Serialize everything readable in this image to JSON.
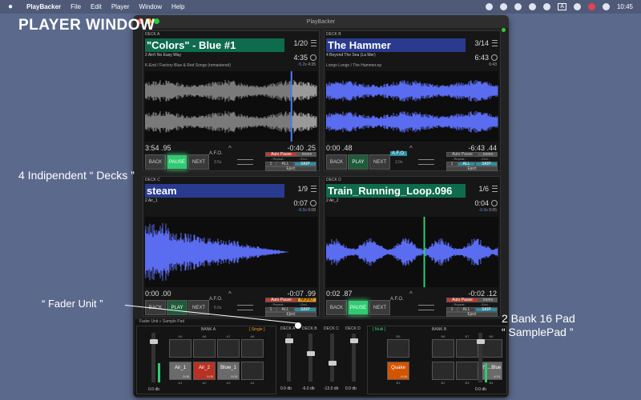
{
  "menubar": {
    "apple": "",
    "app": "PlayBacker",
    "items": [
      "File",
      "Edit",
      "Player",
      "Window",
      "Help"
    ],
    "lang": "A",
    "clock": "10:45"
  },
  "overlay": {
    "title": "PLAYER WINDOW",
    "decks_callout": "4 Indipendent “ Decks ”",
    "fader_callout": "“ Fader Unit ”",
    "pad_callout_1": "2 Bank 16 Pad",
    "pad_callout_2": "“ SamplePad ”"
  },
  "window": {
    "title": "PlayBacker"
  },
  "decks": [
    {
      "label": "DECK A",
      "title": "\"Colors\" - Blue #1",
      "count": "1/20",
      "time": "4:35",
      "sub": "2 Ain't No Easy Way",
      "subtime_neg": "-5.2s",
      "subtime": "4:35",
      "artist": "K-End / Factory Blue & Red Songs (remastered)",
      "elapsed": "3:54 .95",
      "remain": "-0:40 .25",
      "state": "PAUSE",
      "afo_time": "3.5s",
      "auto_pause": "Auto Pause",
      "mono": "mono",
      "repeat": "- Repeat -",
      "end": "- End -",
      "repeat_n": "1",
      "all": "ALL",
      "skip": "SKIP",
      "eject": "Eject",
      "title_bg": "#0f6b4e",
      "auto_on": true,
      "mono_on": false,
      "afo_on": false,
      "all_on": false,
      "playhead": 0.85,
      "wave_color": "#9a9a9a"
    },
    {
      "label": "DECK B",
      "title": "The Hammer",
      "count": "3/14",
      "time": "6:43",
      "sub": "4 Beyond The Sea (La Mer)",
      "subtime_neg": "",
      "subtime": "6:43",
      "artist": "Longo Longo / The Hammer.ep",
      "elapsed": "0:00 .48",
      "remain": "-6:43 .44",
      "state": "PLAY",
      "afo_time": "3.0s",
      "auto_pause": "Auto Pause",
      "mono": "mono",
      "repeat": "- Repeat -",
      "end": "- End -",
      "repeat_n": "1",
      "all": "ALL",
      "skip": "SKIP",
      "eject": "Eject",
      "title_bg": "#2a3b8f",
      "auto_on": false,
      "mono_on": false,
      "afo_on": true,
      "all_on": true,
      "playhead": 0.0,
      "wave_color": "#5a6cf0"
    },
    {
      "label": "DECK C",
      "title": "steam",
      "count": "1/9",
      "time": "0:07",
      "sub": "2 Air_1",
      "subtime_neg": "-0.0s",
      "subtime": "0:08",
      "artist": "",
      "elapsed": "0:00 .00",
      "remain": "-0:07 .99",
      "state": "PLAY",
      "afo_time": "6.0s",
      "auto_pause": "Auto Pause",
      "mono": "MONO",
      "repeat": "- Repeat -",
      "end": "- End -",
      "repeat_n": "1",
      "all": "ALL",
      "skip": "SKIP",
      "eject": "Eject",
      "title_bg": "#2a3b8f",
      "auto_on": true,
      "mono_on": true,
      "afo_on": false,
      "all_on": false,
      "playhead": 0.0,
      "wave_color": "#5a6cf0"
    },
    {
      "label": "DECK D",
      "title": "Train_Running_Loop.096",
      "count": "1/6",
      "time": "0:04",
      "sub": "2 Air_2",
      "subtime_neg": "-0.0s",
      "subtime": "0:05",
      "artist": "",
      "elapsed": "0:02 .87",
      "remain": "-0:02 .12",
      "state": "PAUSE",
      "afo_time": "",
      "auto_pause": "Auto Pause",
      "mono": "mono",
      "repeat": "- Repeat -",
      "end": "- End -",
      "repeat_n": "1",
      "all": "ALL",
      "skip": "SKIP",
      "eject": "Eject",
      "title_bg": "#0f6b4e",
      "auto_on": true,
      "mono_on": false,
      "afo_on": false,
      "all_on": false,
      "playhead": 0.57,
      "wave_color": "#5a6cf0"
    }
  ],
  "buttons": {
    "back": "BACK",
    "next": "NEXT",
    "afo": "A.F.O."
  },
  "padunit": {
    "header": "Fader Unit » Sample Pad",
    "bank_a": {
      "label": "BANK A",
      "mode": "[ Single ]",
      "db": "0.0 db",
      "top_codes": [
        "A5",
        "A6",
        "A7",
        "A8"
      ],
      "bottom_codes": [
        "A1",
        "A2",
        "A3",
        "A4"
      ],
      "pads": [
        {
          "label": "Air_1",
          "time": "0:08",
          "color": "grey"
        },
        {
          "label": "Air_2",
          "time": "0:05",
          "color": "red"
        },
        {
          "label": "Blow_1",
          "time": "0:03",
          "color": "grey"
        },
        {
          "label": "",
          "time": "",
          "color": ""
        }
      ]
    },
    "bank_b": {
      "label": "BANK B",
      "mode": "[ Multi ]",
      "db": "0.0 db",
      "top_codes": [
        "B5",
        "B6",
        "B7",
        "B8"
      ],
      "bottom_codes": [
        "B1",
        "B2",
        "B3",
        "B4"
      ],
      "pads": [
        {
          "label": "Quake",
          "time": "0:09",
          "color": "orange"
        },
        {
          "label": "",
          "time": "",
          "color": ""
        },
        {
          "label": "",
          "time": "",
          "color": ""
        },
        {
          "label": "It's...Blue",
          "time": "4:15",
          "color": "grey"
        }
      ]
    },
    "fader": {
      "decks": [
        "DECK A",
        "DECK B",
        "DECK C",
        "DECK D"
      ],
      "dbs": [
        "0.0 db",
        "-6.0 db",
        "-12.0 db",
        "0.0 db"
      ]
    }
  }
}
